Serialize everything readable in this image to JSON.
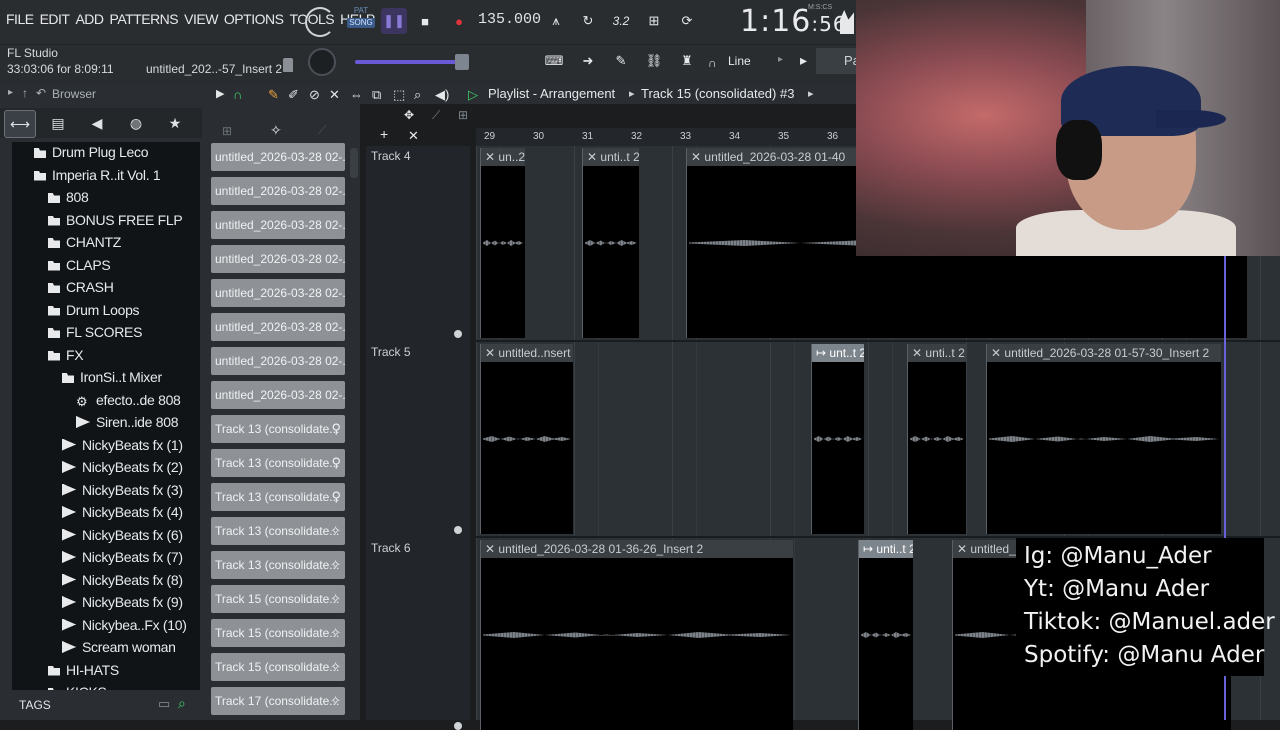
{
  "menu": [
    "FILE",
    "EDIT",
    "ADD",
    "PATTERNS",
    "VIEW",
    "OPTIONS",
    "TOOLS",
    "HELP"
  ],
  "transport": {
    "pat_label": "PAT",
    "song_label": "SONG",
    "tempo": "135.000",
    "clock_main": "1:16",
    "clock_sec": "56",
    "clock_units": "M:S:CS",
    "extra": "3.2"
  },
  "info": {
    "app": "FL Studio",
    "time": "33:03:06 for 8:09:11",
    "hint": "untitled_202..-57_Insert 2"
  },
  "snap": {
    "label": "Line",
    "cut": "Pa"
  },
  "browser": {
    "title": "Browser",
    "items": [
      {
        "label": "Drum Plug Leco",
        "kind": "folder",
        "indent": 1
      },
      {
        "label": "Imperia R..it Vol. 1",
        "kind": "folder",
        "indent": 1
      },
      {
        "label": "808",
        "kind": "folder",
        "indent": 2
      },
      {
        "label": "BONUS FREE FLP",
        "kind": "folder",
        "indent": 2
      },
      {
        "label": "CHANTZ",
        "kind": "folder",
        "indent": 2
      },
      {
        "label": "CLAPS",
        "kind": "folder",
        "indent": 2
      },
      {
        "label": "CRASH",
        "kind": "folder",
        "indent": 2
      },
      {
        "label": "Drum Loops",
        "kind": "folder",
        "indent": 2
      },
      {
        "label": "FL SCORES",
        "kind": "folder",
        "indent": 2
      },
      {
        "label": "FX",
        "kind": "folder",
        "indent": 2
      },
      {
        "label": "IronSi..t Mixer",
        "kind": "folder",
        "indent": 3
      },
      {
        "label": "efecto..de 808",
        "kind": "gear",
        "indent": 4
      },
      {
        "label": "Siren..ide 808",
        "kind": "file",
        "indent": 4
      },
      {
        "label": "NickyBeats fx (1)",
        "kind": "file",
        "indent": 3
      },
      {
        "label": "NickyBeats fx (2)",
        "kind": "file",
        "indent": 3
      },
      {
        "label": "NickyBeats fx (3)",
        "kind": "file",
        "indent": 3
      },
      {
        "label": "NickyBeats fx (4)",
        "kind": "file",
        "indent": 3
      },
      {
        "label": "NickyBeats fx (6)",
        "kind": "file",
        "indent": 3
      },
      {
        "label": "NickyBeats fx (7)",
        "kind": "file",
        "indent": 3
      },
      {
        "label": "NickyBeats fx (8)",
        "kind": "file",
        "indent": 3
      },
      {
        "label": "NickyBeats fx (9)",
        "kind": "file",
        "indent": 3
      },
      {
        "label": "Nickybea..Fx (10)",
        "kind": "file",
        "indent": 3
      },
      {
        "label": "Scream woman",
        "kind": "file",
        "indent": 3
      },
      {
        "label": "HI-HATS",
        "kind": "folder",
        "indent": 2
      },
      {
        "label": "KICKS",
        "kind": "folder",
        "indent": 2
      }
    ],
    "tags_label": "TAGS"
  },
  "clips": [
    {
      "label": "untitled_2026-03-28 02-...",
      "icon": ""
    },
    {
      "label": "untitled_2026-03-28 02-...",
      "icon": ""
    },
    {
      "label": "untitled_2026-03-28 02-...",
      "icon": ""
    },
    {
      "label": "untitled_2026-03-28 02-...",
      "icon": ""
    },
    {
      "label": "untitled_2026-03-28 02-...",
      "icon": ""
    },
    {
      "label": "untitled_2026-03-28 02-...",
      "icon": ""
    },
    {
      "label": "untitled_2026-03-28 02-...",
      "icon": ""
    },
    {
      "label": "untitled_2026-03-28 02-...",
      "icon": ""
    },
    {
      "label": "Track 13 (consolidate...",
      "icon": "⚲"
    },
    {
      "label": "Track 13 (consolidate...",
      "icon": "⚲"
    },
    {
      "label": "Track 13 (consolidate...",
      "icon": "⚲"
    },
    {
      "label": "Track 13 (consolidate...",
      "icon": "✧"
    },
    {
      "label": "Track 13 (consolidate...",
      "icon": "✧"
    },
    {
      "label": "Track 15 (consolidate...",
      "icon": "✧"
    },
    {
      "label": "Track 15 (consolidate...",
      "icon": "✧"
    },
    {
      "label": "Track 15 (consolidate...",
      "icon": "✧"
    },
    {
      "label": "Track 17 (consolidate...",
      "icon": "✧"
    }
  ],
  "playlist": {
    "title": "Playlist - Arrangement",
    "track_sel": "Track 15 (consolidated) #3",
    "ruler": [
      "29",
      "30",
      "31",
      "32",
      "33",
      "34",
      "35",
      "36"
    ],
    "tracks": [
      {
        "name": "Track 4",
        "clips": [
          {
            "label": "✕ un..2"
          },
          {
            "label": "✕ unti..t 2"
          },
          {
            "label": "✕ untitled_2026-03-28 01-40"
          }
        ]
      },
      {
        "name": "Track 5",
        "clips": [
          {
            "label": "✕ untitled..nsert 2"
          },
          {
            "label": "↦ unt..t 2"
          },
          {
            "label": "✕ unti..t 2"
          },
          {
            "label": "✕ untitled_2026-03-28 01-57-30_Insert 2"
          }
        ]
      },
      {
        "name": "Track 6",
        "clips": [
          {
            "label": "✕ untitled_2026-03-28 01-36-26_Insert 2"
          },
          {
            "label": "↦ unti..t 2"
          },
          {
            "label": "✕ untitled_"
          }
        ]
      }
    ]
  },
  "social": [
    "Ig: @Manu_Ader",
    "Yt: @Manu Ader",
    "Tiktok: @Manuel.ader",
    "Spotify: @Manu Ader"
  ]
}
